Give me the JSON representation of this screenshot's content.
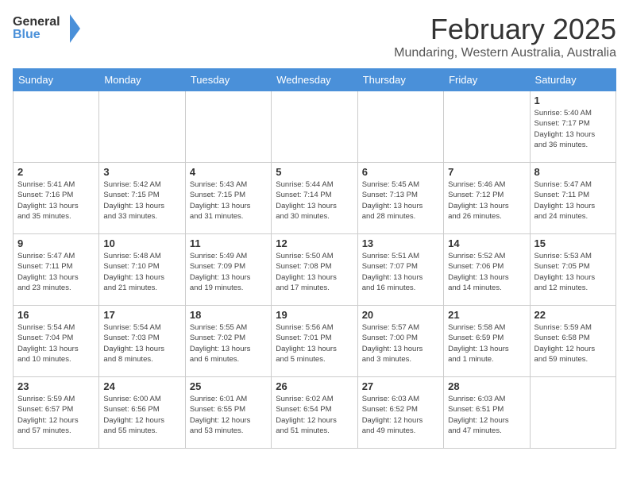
{
  "header": {
    "logo_general": "General",
    "logo_blue": "Blue",
    "month": "February 2025",
    "location": "Mundaring, Western Australia, Australia"
  },
  "days_of_week": [
    "Sunday",
    "Monday",
    "Tuesday",
    "Wednesday",
    "Thursday",
    "Friday",
    "Saturday"
  ],
  "weeks": [
    [
      {
        "day": "",
        "info": ""
      },
      {
        "day": "",
        "info": ""
      },
      {
        "day": "",
        "info": ""
      },
      {
        "day": "",
        "info": ""
      },
      {
        "day": "",
        "info": ""
      },
      {
        "day": "",
        "info": ""
      },
      {
        "day": "1",
        "info": "Sunrise: 5:40 AM\nSunset: 7:17 PM\nDaylight: 13 hours\nand 36 minutes."
      }
    ],
    [
      {
        "day": "2",
        "info": "Sunrise: 5:41 AM\nSunset: 7:16 PM\nDaylight: 13 hours\nand 35 minutes."
      },
      {
        "day": "3",
        "info": "Sunrise: 5:42 AM\nSunset: 7:15 PM\nDaylight: 13 hours\nand 33 minutes."
      },
      {
        "day": "4",
        "info": "Sunrise: 5:43 AM\nSunset: 7:15 PM\nDaylight: 13 hours\nand 31 minutes."
      },
      {
        "day": "5",
        "info": "Sunrise: 5:44 AM\nSunset: 7:14 PM\nDaylight: 13 hours\nand 30 minutes."
      },
      {
        "day": "6",
        "info": "Sunrise: 5:45 AM\nSunset: 7:13 PM\nDaylight: 13 hours\nand 28 minutes."
      },
      {
        "day": "7",
        "info": "Sunrise: 5:46 AM\nSunset: 7:12 PM\nDaylight: 13 hours\nand 26 minutes."
      },
      {
        "day": "8",
        "info": "Sunrise: 5:47 AM\nSunset: 7:11 PM\nDaylight: 13 hours\nand 24 minutes."
      }
    ],
    [
      {
        "day": "9",
        "info": "Sunrise: 5:47 AM\nSunset: 7:11 PM\nDaylight: 13 hours\nand 23 minutes."
      },
      {
        "day": "10",
        "info": "Sunrise: 5:48 AM\nSunset: 7:10 PM\nDaylight: 13 hours\nand 21 minutes."
      },
      {
        "day": "11",
        "info": "Sunrise: 5:49 AM\nSunset: 7:09 PM\nDaylight: 13 hours\nand 19 minutes."
      },
      {
        "day": "12",
        "info": "Sunrise: 5:50 AM\nSunset: 7:08 PM\nDaylight: 13 hours\nand 17 minutes."
      },
      {
        "day": "13",
        "info": "Sunrise: 5:51 AM\nSunset: 7:07 PM\nDaylight: 13 hours\nand 16 minutes."
      },
      {
        "day": "14",
        "info": "Sunrise: 5:52 AM\nSunset: 7:06 PM\nDaylight: 13 hours\nand 14 minutes."
      },
      {
        "day": "15",
        "info": "Sunrise: 5:53 AM\nSunset: 7:05 PM\nDaylight: 13 hours\nand 12 minutes."
      }
    ],
    [
      {
        "day": "16",
        "info": "Sunrise: 5:54 AM\nSunset: 7:04 PM\nDaylight: 13 hours\nand 10 minutes."
      },
      {
        "day": "17",
        "info": "Sunrise: 5:54 AM\nSunset: 7:03 PM\nDaylight: 13 hours\nand 8 minutes."
      },
      {
        "day": "18",
        "info": "Sunrise: 5:55 AM\nSunset: 7:02 PM\nDaylight: 13 hours\nand 6 minutes."
      },
      {
        "day": "19",
        "info": "Sunrise: 5:56 AM\nSunset: 7:01 PM\nDaylight: 13 hours\nand 5 minutes."
      },
      {
        "day": "20",
        "info": "Sunrise: 5:57 AM\nSunset: 7:00 PM\nDaylight: 13 hours\nand 3 minutes."
      },
      {
        "day": "21",
        "info": "Sunrise: 5:58 AM\nSunset: 6:59 PM\nDaylight: 13 hours\nand 1 minute."
      },
      {
        "day": "22",
        "info": "Sunrise: 5:59 AM\nSunset: 6:58 PM\nDaylight: 12 hours\nand 59 minutes."
      }
    ],
    [
      {
        "day": "23",
        "info": "Sunrise: 5:59 AM\nSunset: 6:57 PM\nDaylight: 12 hours\nand 57 minutes."
      },
      {
        "day": "24",
        "info": "Sunrise: 6:00 AM\nSunset: 6:56 PM\nDaylight: 12 hours\nand 55 minutes."
      },
      {
        "day": "25",
        "info": "Sunrise: 6:01 AM\nSunset: 6:55 PM\nDaylight: 12 hours\nand 53 minutes."
      },
      {
        "day": "26",
        "info": "Sunrise: 6:02 AM\nSunset: 6:54 PM\nDaylight: 12 hours\nand 51 minutes."
      },
      {
        "day": "27",
        "info": "Sunrise: 6:03 AM\nSunset: 6:52 PM\nDaylight: 12 hours\nand 49 minutes."
      },
      {
        "day": "28",
        "info": "Sunrise: 6:03 AM\nSunset: 6:51 PM\nDaylight: 12 hours\nand 47 minutes."
      },
      {
        "day": "",
        "info": ""
      }
    ]
  ]
}
